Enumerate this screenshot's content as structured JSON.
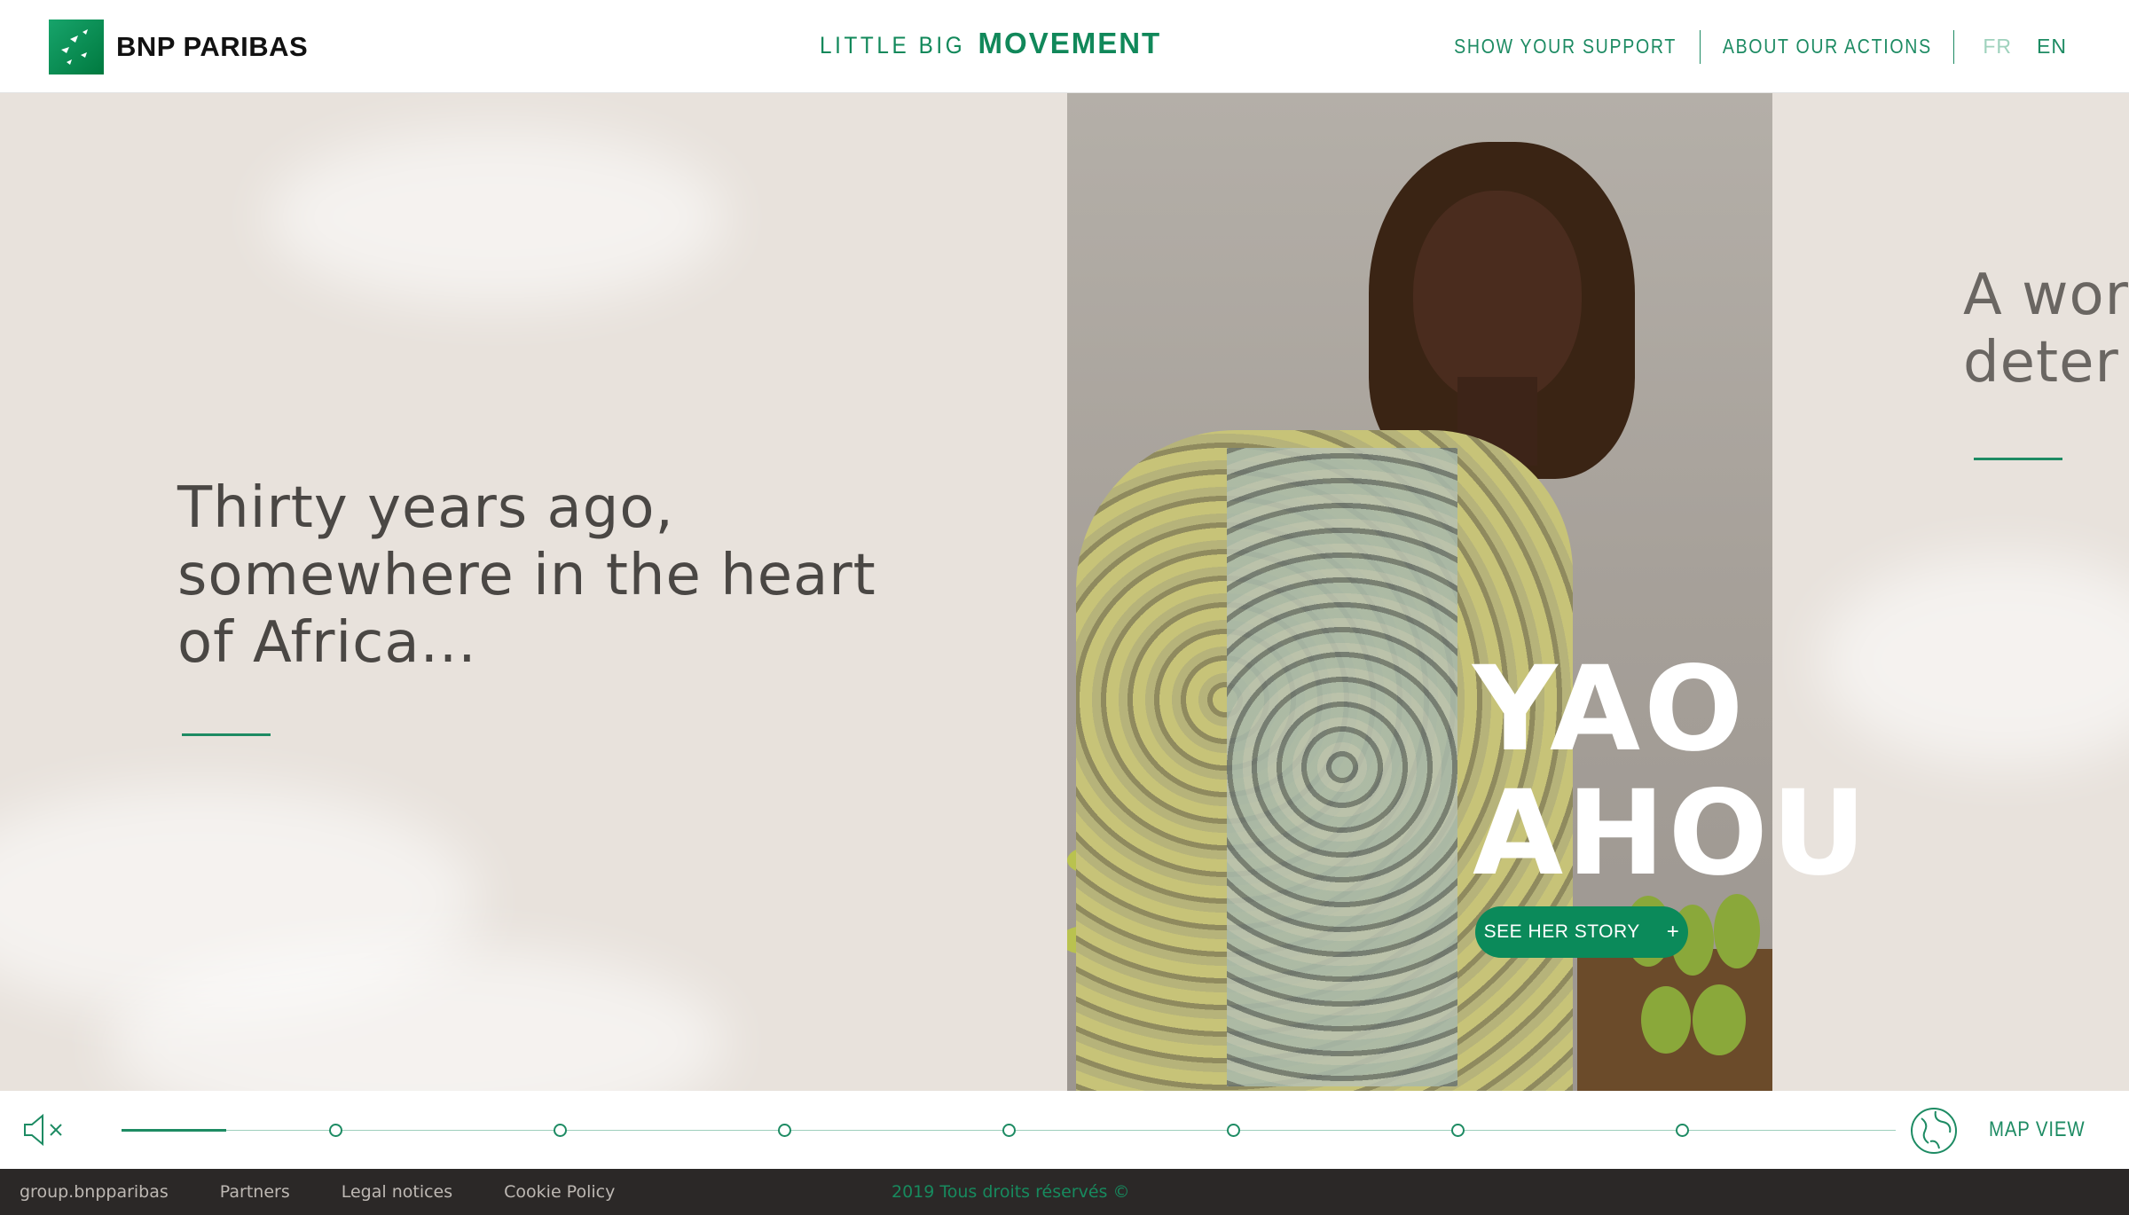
{
  "header": {
    "logo_text": "BNP PARIBAS",
    "brand_thin": "LITTLE BIG",
    "brand_bold": "MOVEMENT",
    "nav": [
      "SHOW YOUR SUPPORT",
      "ABOUT OUR ACTIONS"
    ],
    "lang_fr": "FR",
    "lang_en": "EN"
  },
  "hero": {
    "intro_lines": [
      "Thirty years ago,",
      "somewhere in the heart",
      "of Africa..."
    ],
    "name_first": "YAO",
    "name_last": "AHOU",
    "cta_label": "SEE HER STORY",
    "cta_icon": "plus-icon",
    "next_lines": [
      "A wor",
      "deter"
    ]
  },
  "timeline": {
    "sound_icon": "mute-icon",
    "map_icon": "globe-icon",
    "map_label": "MAP VIEW"
  },
  "footer": {
    "links": [
      "group.bnpparibas",
      "Partners",
      "Legal notices",
      "Cookie Policy"
    ],
    "copyright": "2019 Tous droits réservés ©"
  },
  "colors": {
    "accent": "#1d8b63",
    "button": "#0b8a5a",
    "hero_bg": "#e8e2dc",
    "footer_bg": "#2b2827"
  }
}
